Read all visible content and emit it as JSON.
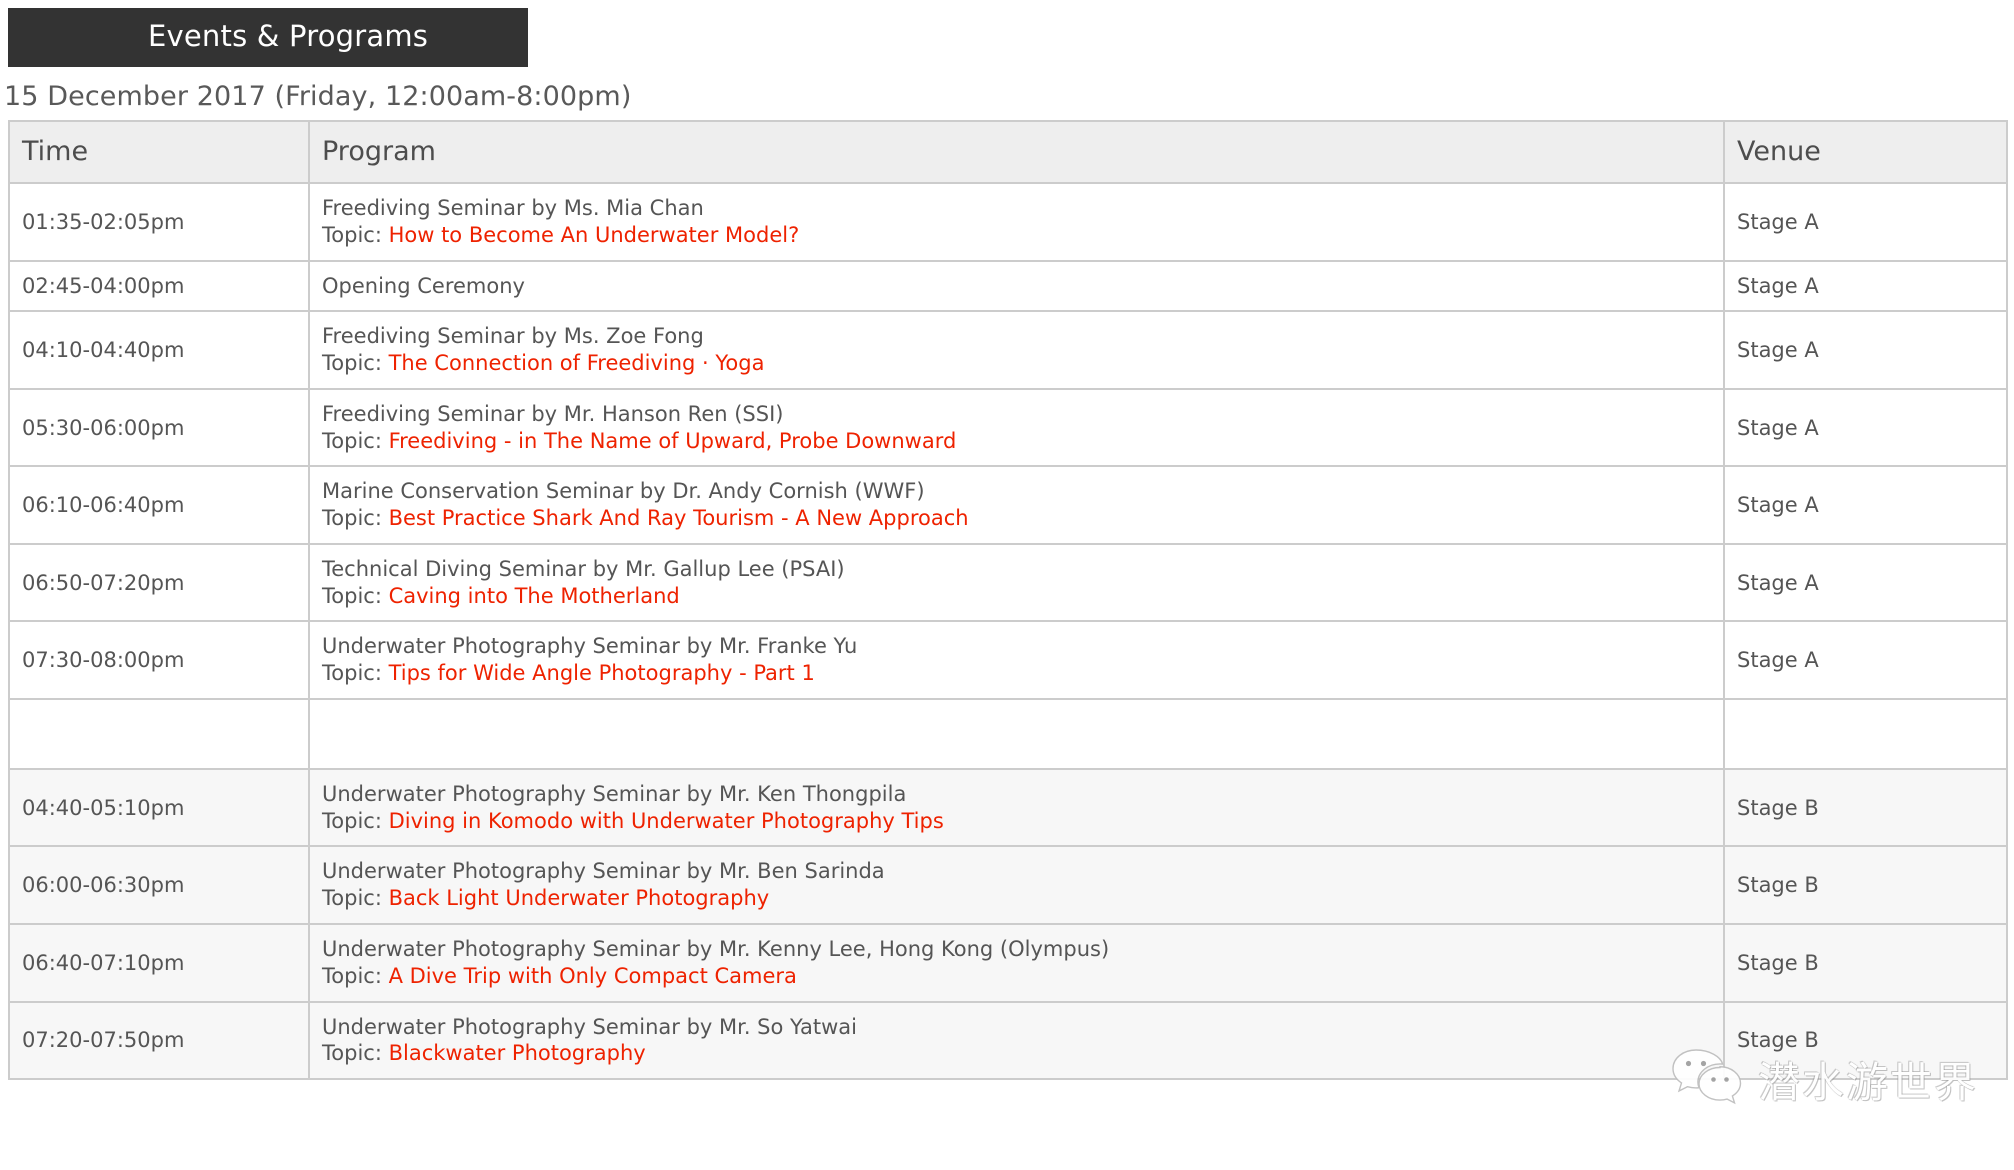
{
  "header": {
    "badge_label": "Events & Programs",
    "badge_bg": "#333333",
    "badge_color": "#ffffff"
  },
  "date_line": "15 December 2017 (Friday, 12:00am-8:00pm)",
  "colors": {
    "topic_red": "#ee2200",
    "body_text": "#555555",
    "header_bg": "#eeeeee",
    "border": "#cccccc",
    "alt_row_bg": "#f7f7f7"
  },
  "table": {
    "columns": [
      "Time",
      "Program",
      "Venue"
    ],
    "topic_prefix": "Topic: ",
    "rows": [
      {
        "time": "01:35-02:05pm",
        "title": "Freediving Seminar by Ms. Mia Chan",
        "topic": "How to Become An Underwater Model?",
        "venue": "Stage A",
        "alt": false
      },
      {
        "time": "02:45-04:00pm",
        "title": "Opening Ceremony",
        "topic": "",
        "venue": "Stage A",
        "alt": false
      },
      {
        "time": "04:10-04:40pm",
        "title": "Freediving Seminar by Ms. Zoe Fong",
        "topic": "The Connection of Freediving · Yoga",
        "venue": "Stage A",
        "alt": false
      },
      {
        "time": "05:30-06:00pm",
        "title": "Freediving Seminar by Mr. Hanson Ren (SSI)",
        "topic": "Freediving - in The Name of Upward, Probe Downward",
        "venue": "Stage A",
        "alt": false
      },
      {
        "time": "06:10-06:40pm",
        "title": "Marine Conservation Seminar by Dr. Andy Cornish (WWF)",
        "topic": "Best Practice Shark And Ray Tourism - A New Approach",
        "venue": "Stage A",
        "alt": false
      },
      {
        "time": "06:50-07:20pm",
        "title": "Technical Diving Seminar by Mr. Gallup Lee (PSAI)",
        "topic": "Caving into The Motherland",
        "venue": "Stage A",
        "alt": false
      },
      {
        "time": "07:30-08:00pm",
        "title": "Underwater Photography Seminar by Mr. Franke Yu",
        "topic": "Tips for Wide Angle Photography - Part 1",
        "venue": "Stage A",
        "alt": false
      },
      {
        "time": "",
        "title": "",
        "topic": "",
        "venue": "",
        "alt": false,
        "spacer": true
      },
      {
        "time": "04:40-05:10pm",
        "title": "Underwater Photography Seminar by Mr. Ken Thongpila",
        "topic": "Diving in Komodo with Underwater Photography Tips",
        "venue": "Stage B",
        "alt": true
      },
      {
        "time": "06:00-06:30pm",
        "title": "Underwater Photography Seminar by Mr. Ben Sarinda",
        "topic": "Back Light Underwater Photography",
        "venue": "Stage B",
        "alt": true
      },
      {
        "time": "06:40-07:10pm",
        "title": "Underwater Photography Seminar by Mr. Kenny Lee, Hong Kong (Olympus)",
        "topic": "A Dive Trip with Only Compact Camera",
        "venue": "Stage B",
        "alt": true
      },
      {
        "time": "07:20-07:50pm",
        "title": "Underwater Photography Seminar by Mr. So Yatwai",
        "topic": "Blackwater Photography",
        "venue": "Stage B",
        "alt": true
      }
    ]
  },
  "watermark": {
    "text": "潜水游世界",
    "icon": "wechat-icon"
  }
}
